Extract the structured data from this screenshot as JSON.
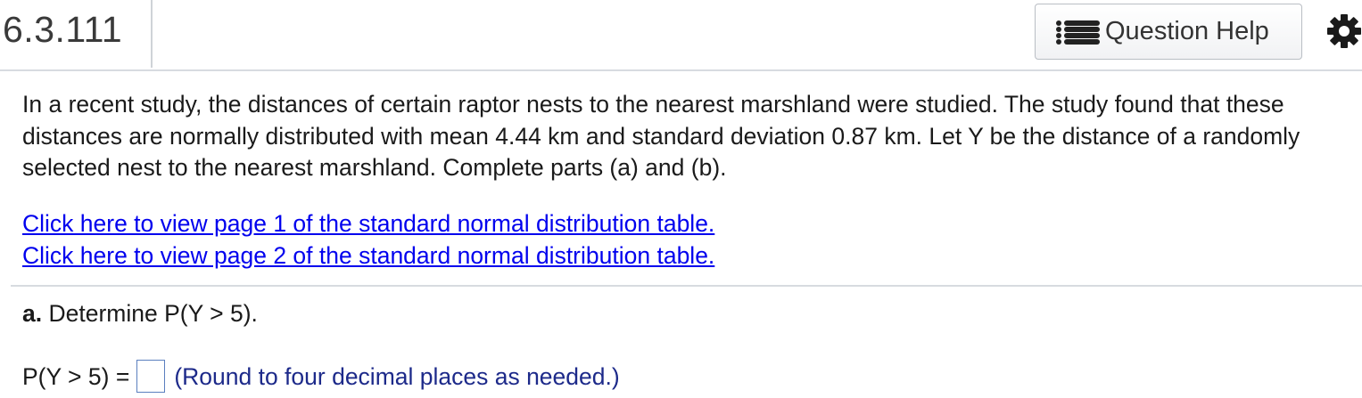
{
  "header": {
    "question_number": "6.3.111",
    "help_button_label": "Question Help",
    "help_icon": "list-icon",
    "settings_icon": "gear-icon"
  },
  "problem": {
    "text": "In a recent study, the distances of certain raptor nests to the nearest marshland were studied. The study found that these distances are normally distributed with mean 4.44 km and standard deviation 0.87 km. Let Y be the distance of a randomly selected nest to the nearest marshland. Complete parts (a) and (b).",
    "links": [
      "Click here to view page 1 of the standard normal distribution table.",
      "Click here to view page 2 of the standard normal distribution table."
    ]
  },
  "part_a": {
    "label": "a.",
    "prompt": "Determine P(Y > 5).",
    "answer_prefix": "P(Y > 5) =",
    "answer_value": "",
    "hint": "(Round to four decimal places as needed.)"
  },
  "colors": {
    "link": "#0000ee",
    "hint": "#1d2a8a",
    "divider": "#d7dbe0"
  }
}
